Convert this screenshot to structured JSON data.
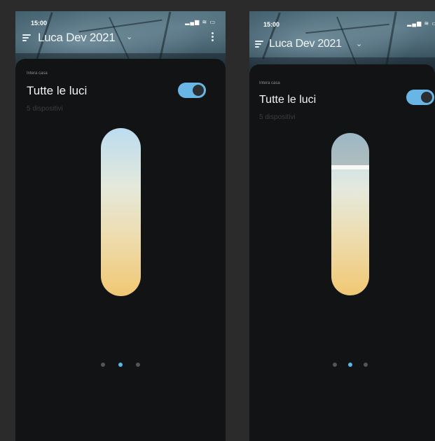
{
  "accent_color": "#69b6e6",
  "screens": [
    {
      "status": {
        "time": "15:00"
      },
      "header": {
        "title": "Luca Dev 2021"
      },
      "group": {
        "room_label": "Intera casa",
        "title": "Tutte le luci",
        "device_count": "5 dispositivi",
        "power_on": true
      },
      "slider": {
        "brightness": 1.0
      },
      "pager": {
        "count": 3,
        "active": 1
      }
    },
    {
      "status": {
        "time": "15:00"
      },
      "header": {
        "title": "Luca Dev 2021"
      },
      "group": {
        "room_label": "Intera casa",
        "title": "Tutte le luci",
        "device_count": "5 dispositivi",
        "power_on": true
      },
      "slider": {
        "brightness": 0.79
      },
      "pager": {
        "count": 3,
        "active": 1
      }
    }
  ]
}
